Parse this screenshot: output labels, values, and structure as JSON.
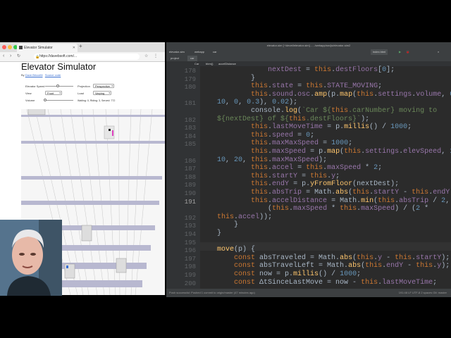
{
  "browser": {
    "tab_title": "Elevator Simulator",
    "url": "https://davebsoft.com/...",
    "page_title": "Elevator Simulator",
    "byline_prefix": "By ",
    "byline_author": "Dave Briccetti",
    "byline_source": "Source code",
    "controls": {
      "elevator_speed_label": "Elevator Speed",
      "projection_label": "Projection",
      "projection_value": "Perspective",
      "view_label": "View",
      "view_value": "Front",
      "load_label": "Load",
      "load_value": "Varying",
      "volume_label": "Volume",
      "status_text": "Waiting: 0, Riding: 3, Served: 772"
    }
  },
  "ide": {
    "window_title": "elevator-sim [~/devel/elevator-sim] - .../webapp/src/js/elevator-sim2",
    "project": "elevator-sim",
    "crumb_webapp": "webapp",
    "crumb_car": "car",
    "run_config": "index.html",
    "file_tabs": [
      "Car",
      "bbm()",
      "accelDistance"
    ],
    "project_label": "project",
    "file_label": "car",
    "status_left": "Push successful: Pushed 1 commit to origin/master (47 minutes ago)",
    "status_right": "191:48   LF   UTF-8   2 spaces   Git: master",
    "line_numbers": [
      "178",
      "179",
      "180",
      "",
      "181",
      "",
      "182",
      "183",
      "184",
      "185",
      "",
      "186",
      "187",
      "188",
      "189",
      "190",
      "191",
      "",
      "192",
      "193",
      "194",
      "195",
      "196",
      "197",
      "198",
      "199",
      "200"
    ]
  },
  "colors": {
    "ide_bg": "#2b2b2b",
    "keyword": "#cc7832",
    "function": "#ffc66d",
    "number": "#6897bb",
    "string": "#6a8759",
    "property": "#9876aa"
  }
}
